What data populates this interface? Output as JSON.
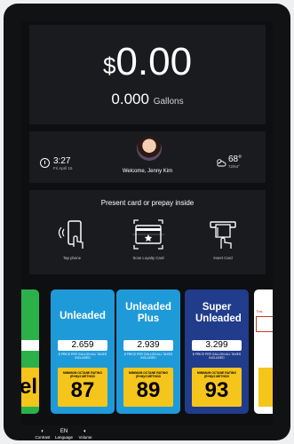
{
  "transaction": {
    "currency": "$",
    "amount": "0.00",
    "gallons": "0.000",
    "gallons_unit": "Gallons"
  },
  "welcome": {
    "time": "3:27",
    "date": "Fri April 15",
    "greeting": "Welcome, Jenny Kim",
    "temperature": "68°",
    "high_low": "72/64°"
  },
  "payment": {
    "title": "Present card or prepay inside",
    "options": [
      {
        "label": "Tap phone",
        "icon": "tap-phone-icon"
      },
      {
        "label": "Scan Loyalty Card",
        "icon": "scan-loyalty-card-icon"
      },
      {
        "label": "Insert Card",
        "icon": "insert-card-icon"
      }
    ]
  },
  "fuel_grades": [
    {
      "name": "Unleaded",
      "price": "2.659",
      "price_note": "$ PRICE PER GALLON ALL TAXES INCLUDED",
      "octane_label": "MINIMUM OCTANE RATING (R+M)/2 METHOD",
      "octane": "87",
      "color": "#1f9ad9"
    },
    {
      "name": "Unleaded Plus",
      "price": "2.939",
      "price_note": "$ PRICE PER GALLON ALL TAXES INCLUDED",
      "octane_label": "MINIMUM OCTANE RATING (R+M)/2 METHOD",
      "octane": "89",
      "color": "#1f9ad9"
    },
    {
      "name": "Super Unleaded",
      "price": "3.299",
      "price_note": "$ PRICE PER GALLON ALL TAXES INCLUDED",
      "octane_label": "MINIMUM OCTANE RATING (R+M)/2 METHOD",
      "octane": "93",
      "color": "#203c8a"
    }
  ],
  "side_cards": {
    "left_fragment": "el",
    "right_fragment": "This"
  },
  "bottom_bar": [
    {
      "label": "Contrast",
      "icon": "contrast-icon"
    },
    {
      "label": "Language",
      "icon": "language-icon",
      "glyph": "EN"
    },
    {
      "label": "Volume",
      "icon": "volume-icon"
    }
  ]
}
